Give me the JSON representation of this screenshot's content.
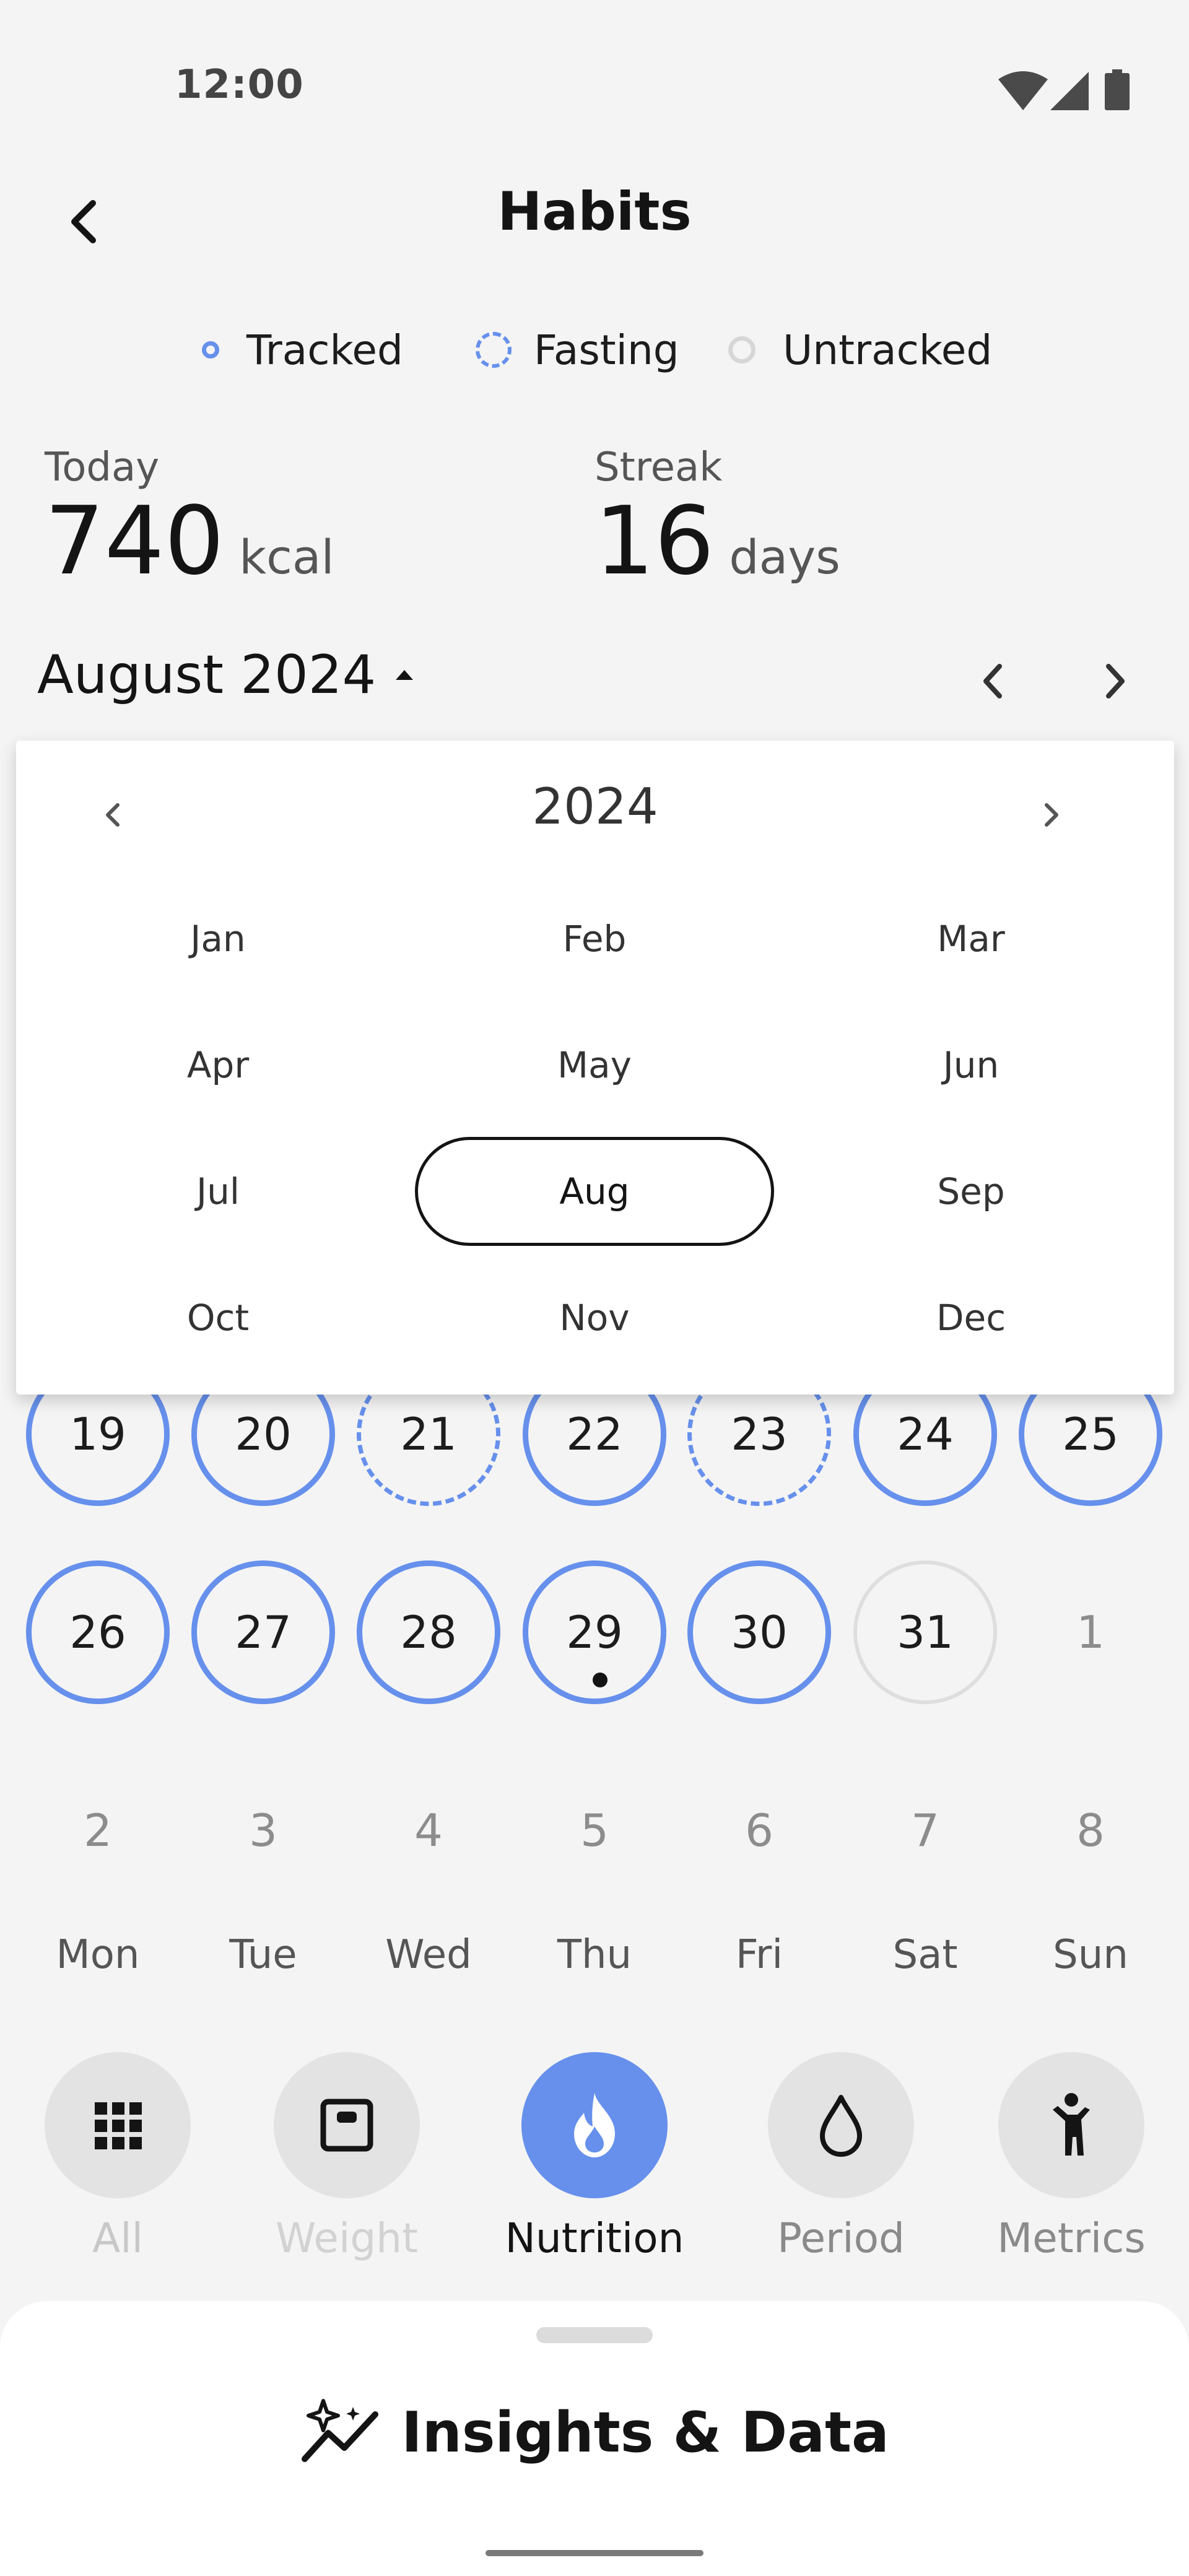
{
  "status_bar": {
    "time": "12:00",
    "icons": [
      "wifi-icon",
      "signal-icon",
      "battery-icon"
    ]
  },
  "header": {
    "title": "Habits",
    "back_icon": "chevron-left-icon"
  },
  "legend": [
    {
      "label": "Tracked",
      "style": "solid"
    },
    {
      "label": "Fasting",
      "style": "dashed"
    },
    {
      "label": "Untracked",
      "style": "grey"
    }
  ],
  "stats": {
    "today": {
      "label": "Today",
      "value": "740",
      "unit": "kcal"
    },
    "streak": {
      "label": "Streak",
      "value": "16",
      "unit": "days"
    }
  },
  "calendar": {
    "month_label": "August 2024",
    "prev_icon": "chevron-left-icon",
    "next_icon": "chevron-right-icon",
    "rows": [
      [
        {
          "d": "19",
          "s": "tracked"
        },
        {
          "d": "20",
          "s": "tracked"
        },
        {
          "d": "21",
          "s": "fasting"
        },
        {
          "d": "22",
          "s": "tracked"
        },
        {
          "d": "23",
          "s": "fasting"
        },
        {
          "d": "24",
          "s": "tracked"
        },
        {
          "d": "25",
          "s": "tracked"
        }
      ],
      [
        {
          "d": "26",
          "s": "tracked"
        },
        {
          "d": "27",
          "s": "tracked"
        },
        {
          "d": "28",
          "s": "tracked"
        },
        {
          "d": "29",
          "s": "tracked",
          "today": true
        },
        {
          "d": "30",
          "s": "tracked"
        },
        {
          "d": "31",
          "s": "untracked"
        },
        {
          "d": "1",
          "s": "plain"
        }
      ],
      [
        {
          "d": "2",
          "s": "plain"
        },
        {
          "d": "3",
          "s": "plain"
        },
        {
          "d": "4",
          "s": "plain"
        },
        {
          "d": "5",
          "s": "plain"
        },
        {
          "d": "6",
          "s": "plain"
        },
        {
          "d": "7",
          "s": "plain"
        },
        {
          "d": "8",
          "s": "plain"
        }
      ]
    ],
    "weekdays": [
      "Mon",
      "Tue",
      "Wed",
      "Thu",
      "Fri",
      "Sat",
      "Sun"
    ]
  },
  "month_picker": {
    "year": "2024",
    "months": [
      "Jan",
      "Feb",
      "Mar",
      "Apr",
      "May",
      "Jun",
      "Jul",
      "Aug",
      "Sep",
      "Oct",
      "Nov",
      "Dec"
    ],
    "selected": "Aug"
  },
  "categories": [
    {
      "label": "All",
      "icon": "grid-icon",
      "active": false,
      "label_color": "#c8c8c8"
    },
    {
      "label": "Weight",
      "icon": "scale-icon",
      "active": false,
      "label_color": "#d2d2d2"
    },
    {
      "label": "Nutrition",
      "icon": "flame-icon",
      "active": true,
      "label_color": "#141414"
    },
    {
      "label": "Period",
      "icon": "drop-icon",
      "active": false,
      "label_color": "#8a8a8a"
    },
    {
      "label": "Metrics",
      "icon": "person-icon",
      "active": false,
      "label_color": "#8a8a8a"
    }
  ],
  "sheet": {
    "title": "Insights & Data",
    "icon": "sparkle-chart-icon"
  },
  "colors": {
    "accent": "#6690ec",
    "background": "#f4f4f4",
    "untracked": "#dedede"
  }
}
